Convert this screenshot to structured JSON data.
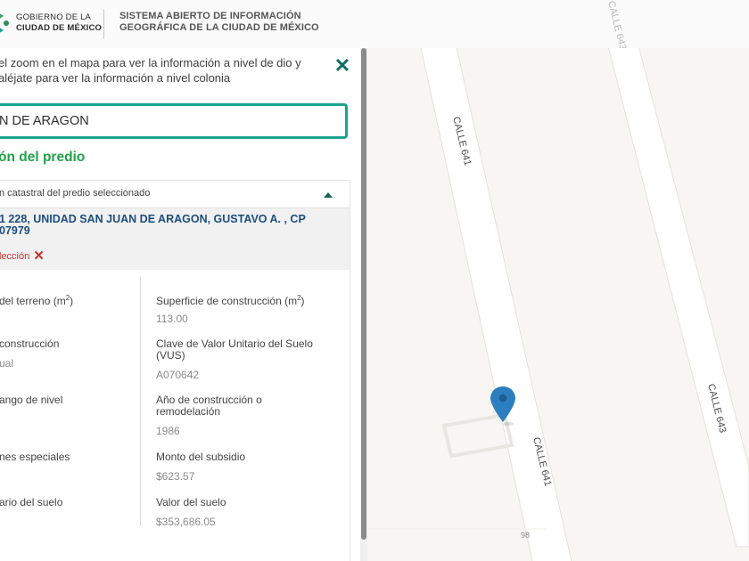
{
  "header": {
    "logo_line1": "GOBIERNO DE LA",
    "logo_line2": "CIUDAD DE MÉXICO",
    "system_title_line1": "SISTEMA ABIERTO DE INFORMACIÓN",
    "system_title_line2": "GEOGRÁFICA DE LA CIUDAD DE MÉXICO"
  },
  "panel": {
    "instructions": "el zoom en el mapa para ver la información a nivel de dio y aléjate para ver la información a nivel colonia",
    "close_icon": "close-icon",
    "search_value": "N DE ARAGON",
    "section_title": "ón del predio",
    "card": {
      "header": "n catastral del predio seleccionado",
      "address": "1 228, UNIDAD SAN JUAN DE ARAGON, GUSTAVO A. , CP 07979",
      "clear_selection": "lección",
      "fields": [
        {
          "label": "del terreno (m",
          "unit_sup": "2",
          "label_end": ")",
          "value": ""
        },
        {
          "label": "Superficie de construcción (m",
          "unit_sup": "2",
          "label_end": ")",
          "value": "113.00"
        },
        {
          "label": "construcción",
          "value": "ual"
        },
        {
          "label": "Clave de Valor Unitario del Suelo (VUS)",
          "value": "A070642"
        },
        {
          "label": "ango de nivel",
          "value": ""
        },
        {
          "label": "Año de construcción o remodelación",
          "value": "1986"
        },
        {
          "label": "nes especiales",
          "value": ""
        },
        {
          "label": "Monto del subsidio",
          "value": "$623.57"
        },
        {
          "label": "ario del suelo",
          "value": ""
        },
        {
          "label": "Valor del suelo",
          "value": "$353,686.05"
        }
      ]
    }
  },
  "map": {
    "streets": [
      {
        "name": "CALLE 641"
      },
      {
        "name": "CALLE 641"
      },
      {
        "name": "CALLE 643"
      },
      {
        "name": "CALLE 643"
      }
    ],
    "lot_number": "98",
    "marker_icon": "map-pin-icon",
    "marker_color": "#2b7fc0"
  },
  "colors": {
    "accent_teal": "#1aa390",
    "section_green": "#22a34a",
    "address_blue": "#1c4e7e",
    "clear_red": "#d0312d"
  }
}
